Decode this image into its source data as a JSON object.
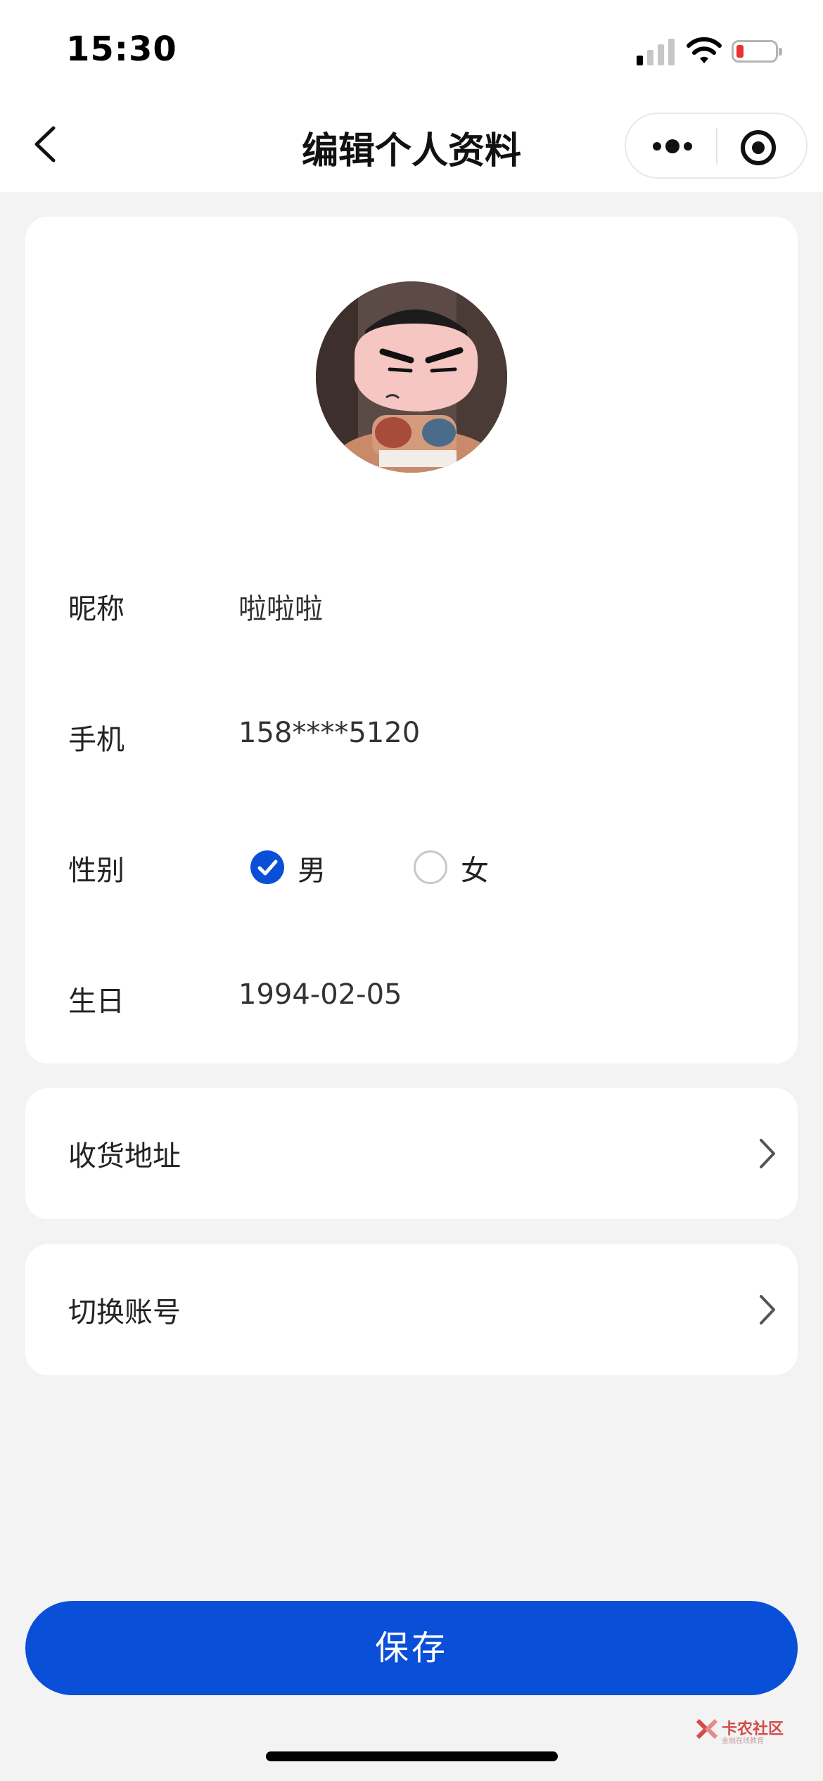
{
  "status_bar": {
    "time": "15:30"
  },
  "nav": {
    "title": "编辑个人资料"
  },
  "profile": {
    "nickname": {
      "label": "昵称",
      "value": "啦啦啦"
    },
    "phone": {
      "label": "手机",
      "value": "158****5120"
    },
    "gender": {
      "label": "性别",
      "options": [
        "男",
        "女"
      ],
      "selected": "男"
    },
    "birthday": {
      "label": "生日",
      "value": "1994-02-05"
    }
  },
  "menu": {
    "address": "收货地址",
    "switch_account": "切换账号"
  },
  "save_label": "保存",
  "watermark": {
    "text": "卡农社区",
    "sub": "金融在线教育"
  },
  "colors": {
    "accent": "#0a4fd8",
    "background": "#f3f3f3",
    "card": "#ffffff"
  },
  "icons": [
    "back-arrow-icon",
    "more-dots-icon",
    "target-circle-icon",
    "check-icon",
    "chevron-right-icon"
  ]
}
